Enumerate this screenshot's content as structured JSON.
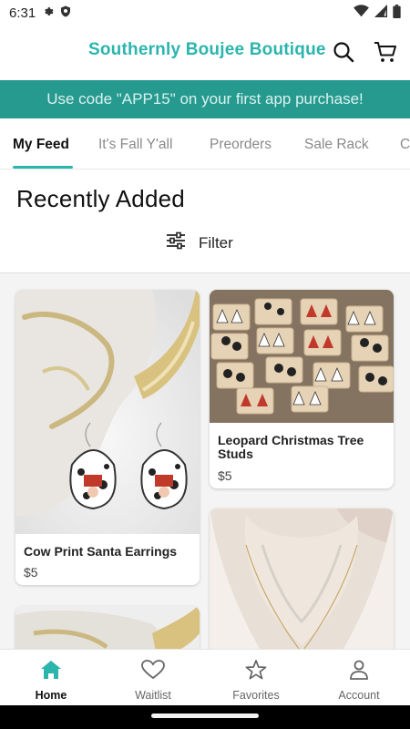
{
  "status_bar": {
    "time": "6:31"
  },
  "header": {
    "brand": "Southernly Boujee Boutique",
    "icons": [
      "search-icon",
      "cart-icon"
    ]
  },
  "promo": {
    "text": "Use code \"APP15\" on your first app purchase!"
  },
  "tabs": [
    {
      "label": "My Feed",
      "active": true
    },
    {
      "label": "It's Fall Y'all"
    },
    {
      "label": "Preorders"
    },
    {
      "label": "Sale Rack"
    },
    {
      "label": "C"
    }
  ],
  "section": {
    "title": "Recently Added",
    "filter_label": "Filter"
  },
  "products": [
    {
      "name": "Cow Print Santa Earrings",
      "price": "$5"
    },
    {
      "name": "Leopard Christmas Tree Studs",
      "price": "$5"
    }
  ],
  "bottom_nav": [
    {
      "label": "Home",
      "icon": "home-icon",
      "active": true
    },
    {
      "label": "Waitlist",
      "icon": "heart-icon"
    },
    {
      "label": "Favorites",
      "icon": "star-icon"
    },
    {
      "label": "Account",
      "icon": "account-icon"
    }
  ],
  "colors": {
    "accent": "#2bb5ad",
    "promo_bg": "#279a90"
  }
}
